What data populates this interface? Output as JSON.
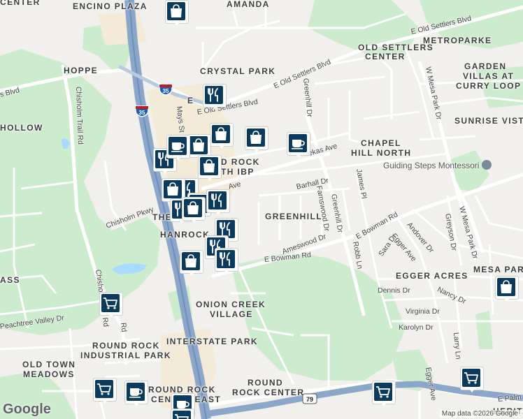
{
  "map": {
    "areas": [
      {
        "id": "encino",
        "label": "ENCINO PLAZA"
      },
      {
        "id": "amanda",
        "label": "AMANDA"
      },
      {
        "id": "metroparke",
        "label": "METROPARKE"
      },
      {
        "id": "osc1",
        "label": "OLD SETTLERS"
      },
      {
        "id": "osc2",
        "label": "CENTER"
      },
      {
        "id": "hoppe",
        "label": "HOPPE"
      },
      {
        "id": "crystal",
        "label": "CRYSTAL PARK"
      },
      {
        "id": "garden1",
        "label": "GARDEN"
      },
      {
        "id": "garden2",
        "label": "VILLAS AT"
      },
      {
        "id": "garden3",
        "label": "CURRY LOOP"
      },
      {
        "id": "sunrise",
        "label": "SUNRISE VISTA"
      },
      {
        "id": "hollow",
        "label": "HOLLOW"
      },
      {
        "id": "chapel1",
        "label": "CHAPEL"
      },
      {
        "id": "chapel2",
        "label": "HILL NORTH"
      },
      {
        "id": "rribp1",
        "label": "D ROCK"
      },
      {
        "id": "rribp2",
        "label": "TH IBP"
      },
      {
        "id": "greenhill",
        "label": "GREENHILL"
      },
      {
        "id": "the",
        "label": "THE"
      },
      {
        "id": "hanrock",
        "label": "HANROCK"
      },
      {
        "id": "mesa",
        "label": "MESA PARK"
      },
      {
        "id": "egger",
        "label": "EGGER ACRES"
      },
      {
        "id": "ass",
        "label": "ASS"
      },
      {
        "id": "onion1",
        "label": "ONION CREEK"
      },
      {
        "id": "onion2",
        "label": "VILLAGE"
      },
      {
        "id": "interstate",
        "label": "INTERSTATE PARK"
      },
      {
        "id": "rrip1",
        "label": "ROUND ROCK"
      },
      {
        "id": "rrip2",
        "label": "INDUSTRIAL PARK"
      },
      {
        "id": "oldtown1",
        "label": "OLD TOWN"
      },
      {
        "id": "oldtown2",
        "label": "MEADOWS"
      },
      {
        "id": "rrc1",
        "label": "ROUND"
      },
      {
        "id": "rrc2",
        "label": "ROCK CENTER"
      },
      {
        "id": "rrce1",
        "label": "ROUND ROCK"
      },
      {
        "id": "rrce2",
        "label": "CENTER EAST"
      },
      {
        "id": "herita",
        "label": "HERITA"
      },
      {
        "id": "center",
        "label": "CENTER"
      },
      {
        "id": "cut",
        "label": "E"
      }
    ],
    "roads": [
      {
        "id": "eold1",
        "label": "E Old Settlers Blvd"
      },
      {
        "id": "eold2",
        "label": "E Old Settlers Blvd"
      },
      {
        "id": "eold3",
        "label": "E Old Settlers Blvd"
      },
      {
        "id": "sblvd",
        "label": "s Blvd"
      },
      {
        "id": "chisholm",
        "label": "Chisholm Trail Rd"
      },
      {
        "id": "chisholm2",
        "label": "Chisholm Trail Rd"
      },
      {
        "id": "chpkwy",
        "label": "Chisholm Pkwy"
      },
      {
        "id": "greenhilldr1",
        "label": "Greenhill Dr"
      },
      {
        "id": "greenhilldr2",
        "label": "Greenhill Dr"
      },
      {
        "id": "barhall",
        "label": "Barhall Dr"
      },
      {
        "id": "farnswood",
        "label": "Farnswood Dr"
      },
      {
        "id": "robb",
        "label": "Robb Ln"
      },
      {
        "id": "ameswood",
        "label": "Ameswood Dr"
      },
      {
        "id": "bowman1",
        "label": "E Bowman Rd"
      },
      {
        "id": "bowman2",
        "label": "E Bowman Rd"
      },
      {
        "id": "jamespl",
        "label": "James Pl"
      },
      {
        "id": "wmesa1",
        "label": "W Mesa Park Dr"
      },
      {
        "id": "wmesa2",
        "label": "W Mesa Park Dr"
      },
      {
        "id": "greyson",
        "label": "Greyson Dr"
      },
      {
        "id": "andover",
        "label": "Andover Dr"
      },
      {
        "id": "eggerave",
        "label": "Egger Ave"
      },
      {
        "id": "eggerave2",
        "label": "Egger Ave"
      },
      {
        "id": "sara",
        "label": "Sara Dr"
      },
      {
        "id": "dennis",
        "label": "Dennis Dr"
      },
      {
        "id": "nancy",
        "label": "Nancy Dr"
      },
      {
        "id": "virginia",
        "label": "Virginia Dr"
      },
      {
        "id": "karolyn",
        "label": "Karolyn Dr"
      },
      {
        "id": "larry",
        "label": "Larry Ln"
      },
      {
        "id": "peachtree",
        "label": "Peachtree Valley Dr"
      },
      {
        "id": "ave1",
        "label": "ekas Ave"
      },
      {
        "id": "ave2",
        "label": "Ave"
      },
      {
        "id": "epalm",
        "label": "E Palm"
      },
      {
        "id": "mst",
        "label": "Mays St"
      },
      {
        "id": "rd",
        "label": "Rd"
      }
    ],
    "poi": {
      "label": "Guiding Steps Montessori"
    },
    "shields": [
      {
        "id": "i35a",
        "label": "35"
      },
      {
        "id": "i35b",
        "label": "35"
      },
      {
        "id": "r79",
        "label": "79"
      }
    ],
    "credit": "Map data ©2026 Google",
    "logo": "Google",
    "colors": {
      "park": "#cdeccd",
      "highway": "#8aa6c9",
      "road": "#ffffff",
      "pin": "#0b3a5c",
      "water": "#aadaff"
    }
  },
  "markers": [
    {
      "id": "m1",
      "icon": "restaurant-icon"
    },
    {
      "id": "m2",
      "icon": "shopping-bag-icon"
    },
    {
      "id": "m3",
      "icon": "shopping-bag-icon"
    },
    {
      "id": "m4",
      "icon": "coffee-icon"
    },
    {
      "id": "m5",
      "icon": "shopping-bag-icon"
    },
    {
      "id": "m6",
      "icon": "shopping-bag-icon"
    },
    {
      "id": "m7",
      "icon": "restaurant-icon"
    },
    {
      "id": "m8",
      "icon": "coffee-icon"
    },
    {
      "id": "m9",
      "icon": "shopping-bag-icon"
    },
    {
      "id": "m10",
      "icon": "restaurant-icon"
    },
    {
      "id": "m11",
      "icon": "shopping-bag-icon"
    },
    {
      "id": "m12",
      "icon": "restaurant-icon"
    },
    {
      "id": "m13",
      "icon": "restaurant-icon"
    },
    {
      "id": "m14",
      "icon": "restaurant-icon"
    },
    {
      "id": "m15",
      "icon": "shopping-bag-icon"
    },
    {
      "id": "m16",
      "icon": "restaurant-icon"
    },
    {
      "id": "m17",
      "icon": "restaurant-icon"
    },
    {
      "id": "m18",
      "icon": "shopping-bag-icon"
    },
    {
      "id": "m19",
      "icon": "restaurant-icon"
    },
    {
      "id": "m20",
      "icon": "cart-icon"
    },
    {
      "id": "m21",
      "icon": "cart-icon"
    },
    {
      "id": "m22",
      "icon": "coffee-icon"
    },
    {
      "id": "m23",
      "icon": "coffee-icon"
    },
    {
      "id": "m24",
      "icon": "cart-icon"
    },
    {
      "id": "m25",
      "icon": "cart-icon"
    },
    {
      "id": "m26",
      "icon": "shopping-bag-icon"
    },
    {
      "id": "m27",
      "icon": "cart-icon"
    }
  ]
}
